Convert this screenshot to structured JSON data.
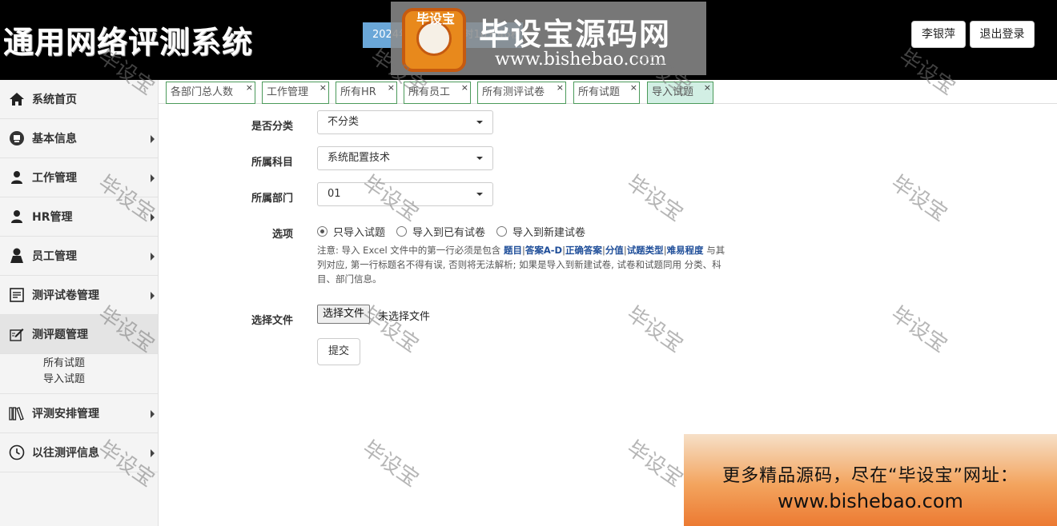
{
  "header": {
    "app_title": "通用网络评测系统",
    "datetime": "2024年1月17日14时16分46秒",
    "logo_cn": "毕设宝源码网",
    "logo_url": "www.bishebao.com",
    "logo_badge": "毕设宝",
    "user_name": "李银萍",
    "logout_label": "退出登录"
  },
  "sidebar": {
    "items": [
      {
        "label": "系统首页",
        "icon": "home-icon"
      },
      {
        "label": "基本信息",
        "icon": "info-icon"
      },
      {
        "label": "工作管理",
        "icon": "user-icon"
      },
      {
        "label": "HR管理",
        "icon": "user-group-icon"
      },
      {
        "label": "员工管理",
        "icon": "user-icon"
      },
      {
        "label": "测评试卷管理",
        "icon": "document-icon"
      },
      {
        "label": "测评题管理",
        "icon": "edit-icon"
      },
      {
        "label": "评测安排管理",
        "icon": "books-icon"
      },
      {
        "label": "以往测评信息",
        "icon": "clock-icon"
      }
    ],
    "sub_items": [
      "所有试题",
      "导入试题"
    ]
  },
  "tabs": [
    "各部门总人数",
    "工作管理",
    "所有HR",
    "所有员工",
    "所有测评试卷",
    "所有试题",
    "导入试题"
  ],
  "form": {
    "classify_label": "是否分类",
    "classify_value": "不分类",
    "subject_label": "所属科目",
    "subject_value": "系统配置技术",
    "dept_label": "所属部门",
    "dept_value": "01",
    "options_label": "选项",
    "options": [
      "只导入试题",
      "导入到已有试卷",
      "导入到新建试卷"
    ],
    "selected_option": 0,
    "note_prefix": "注意: 导入 Excel 文件中的第一行必须是包含 ",
    "note_fields": [
      "题目",
      "答案A-D",
      "正确答案",
      "分值",
      "试题类型",
      "难易程度"
    ],
    "note_suffix": " 与其列对应, 第一行标题名不得有误, 否则将无法解析; 如果是导入到新建试卷, 试卷和试题同用 分类、科目、部门信息。",
    "file_label": "选择文件",
    "file_button": "选择文件",
    "file_status": "未选择文件",
    "submit_label": "提交"
  },
  "watermark": "毕设宝",
  "ad": {
    "line1": "更多精品源码，尽在“毕设宝”网址：",
    "line2": "www.bishebao.com"
  }
}
